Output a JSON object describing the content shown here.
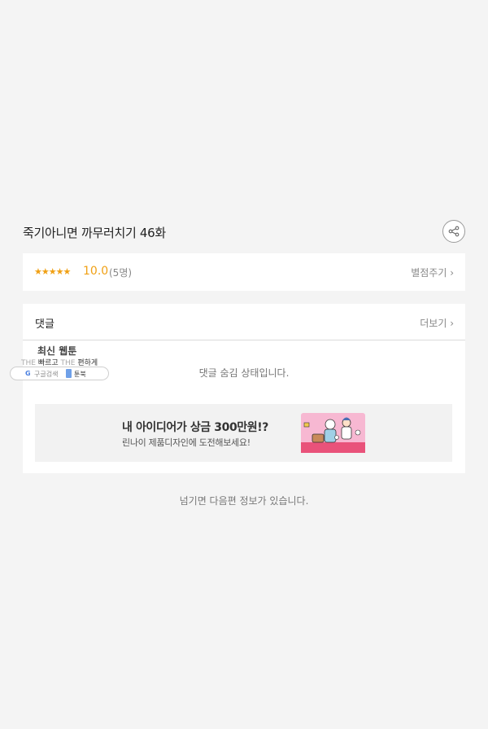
{
  "episode": {
    "title": "죽기아니면 까무러치기 46화"
  },
  "rating": {
    "stars": "★★★★★",
    "score": "10.0",
    "count": "(5명)",
    "rate_link": "별점주기 ›"
  },
  "comments": {
    "title": "댓글",
    "more_link": "더보기 ›",
    "hidden_notice": "댓글 숨김 상태입니다."
  },
  "ad_banner": {
    "headline": "내 아이디어가 상금 300만원!?",
    "subtext": "린나이 제품디자인에 도전해보세요!"
  },
  "floating_ad": {
    "title": "최신 웹툰",
    "tagline_the1": "THE",
    "tagline_word1": "빠르고",
    "tagline_the2": "THE",
    "tagline_word2": "편하게",
    "google_g": "G",
    "google_label": "구글검색",
    "book_label": "툰북"
  },
  "footer": {
    "note": "넘기면 다음편 정보가 있습니다."
  },
  "colors": {
    "background": "#f4f4f4",
    "star": "#f0a014",
    "card": "#ffffff",
    "ad_background": "#f2f2f2"
  },
  "icons": {
    "share": "share-icon"
  }
}
